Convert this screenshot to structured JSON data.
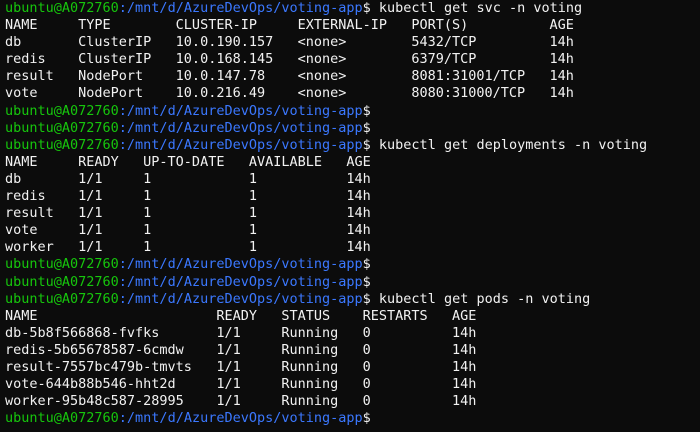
{
  "colors": {
    "background": "#0c0c0c",
    "user": "#16c60c",
    "path": "#3b78ff",
    "text": "#f2f2f2"
  },
  "prompt": {
    "user": "ubuntu@A072760",
    "path": ":/mnt/d/AzureDevOps/voting-app",
    "symbol": "$"
  },
  "commands": {
    "svc": "kubectl get svc -n voting",
    "deployments": "kubectl get deployments -n voting",
    "pods": "kubectl get pods -n voting"
  },
  "svc_output": [
    "NAME     TYPE        CLUSTER-IP     EXTERNAL-IP   PORT(S)          AGE",
    "db       ClusterIP   10.0.190.157   <none>        5432/TCP         14h",
    "redis    ClusterIP   10.0.168.145   <none>        6379/TCP         14h",
    "result   NodePort    10.0.147.78    <none>        8081:31001/TCP   14h",
    "vote     NodePort    10.0.216.49    <none>        8080:31000/TCP   14h"
  ],
  "deployments_output": [
    "NAME     READY   UP-TO-DATE   AVAILABLE   AGE",
    "db       1/1     1            1           14h",
    "redis    1/1     1            1           14h",
    "result   1/1     1            1           14h",
    "vote     1/1     1            1           14h",
    "worker   1/1     1            1           14h"
  ],
  "pods_output": [
    "NAME                      READY   STATUS    RESTARTS   AGE",
    "db-5b8f566868-fvfks       1/1     Running   0          14h",
    "redis-5b65678587-6cmdw    1/1     Running   0          14h",
    "result-7557bc479b-tmvts   1/1     Running   0          14h",
    "vote-644b88b546-hht2d     1/1     Running   0          14h",
    "worker-95b48c587-28995    1/1     Running   0          14h"
  ]
}
